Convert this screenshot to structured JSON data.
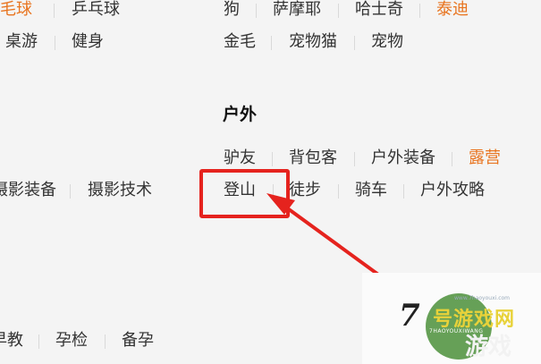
{
  "left_column": {
    "row1": [
      "羽毛球",
      "乒乓球"
    ],
    "row2": [
      "桌游",
      "健身"
    ],
    "row3": [
      "摄影装备",
      "摄影技术"
    ],
    "row4": [
      "早教",
      "孕检",
      "备孕"
    ]
  },
  "pets": {
    "row1": [
      "狗",
      "萨摩耶",
      "哈士奇",
      "泰迪"
    ],
    "row2": [
      "金毛",
      "宠物猫",
      "宠物"
    ]
  },
  "outdoor": {
    "title": "户外",
    "row1": [
      "驴友",
      "背包客",
      "户外装备",
      "露营"
    ],
    "row2": [
      "登山",
      "徒步",
      "骑车",
      "户外攻略"
    ]
  },
  "watermark": {
    "number": "7",
    "brand_top": "号游戏网",
    "brand_bottom": "游戏",
    "pinyin": "7HAOYOUXIWANG",
    "url": "www.7haoyouxi.com"
  },
  "colors": {
    "link": "#333333",
    "hot_link": "#e8741f",
    "highlight": "#e5231e"
  }
}
